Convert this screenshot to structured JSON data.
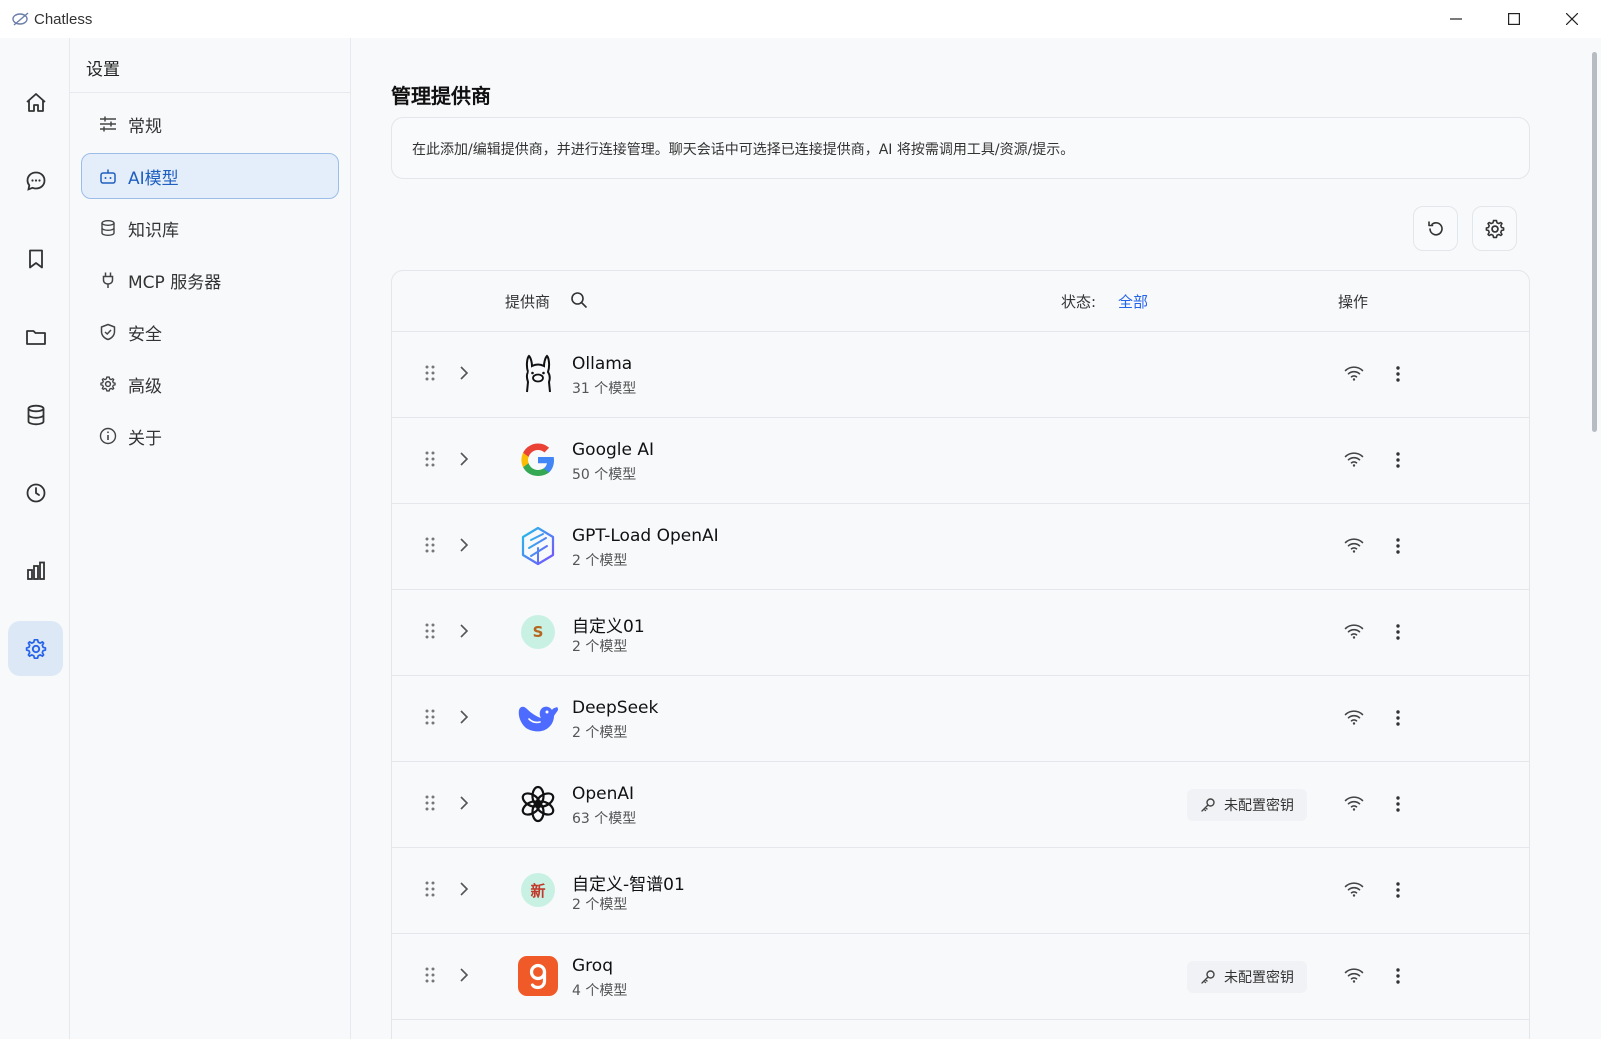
{
  "window": {
    "title": "Chatless"
  },
  "rail": {
    "items": [
      {
        "id": "home",
        "icon": "home-icon"
      },
      {
        "id": "chat",
        "icon": "chat-bubble-icon"
      },
      {
        "id": "bookmarks",
        "icon": "bookmark-icon"
      },
      {
        "id": "files",
        "icon": "folder-icon"
      },
      {
        "id": "database",
        "icon": "database-icon"
      },
      {
        "id": "history",
        "icon": "clock-icon"
      },
      {
        "id": "analytics",
        "icon": "bar-chart-icon"
      },
      {
        "id": "settings",
        "icon": "gear-icon",
        "active": true
      }
    ]
  },
  "sidebar": {
    "title": "设置",
    "items": [
      {
        "label": "常规",
        "icon": "sliders-icon"
      },
      {
        "label": "AI模型",
        "icon": "robot-icon",
        "active": true
      },
      {
        "label": "知识库",
        "icon": "database-icon"
      },
      {
        "label": "MCP 服务器",
        "icon": "plug-icon"
      },
      {
        "label": "安全",
        "icon": "shield-icon"
      },
      {
        "label": "高级",
        "icon": "gear-icon"
      },
      {
        "label": "关于",
        "icon": "info-icon"
      }
    ]
  },
  "main": {
    "title": "管理提供商",
    "description": "在此添加/编辑提供商，并进行连接管理。聊天会话中可选择已连接提供商，AI 将按需调用工具/资源/提示。",
    "toolbar": {
      "refresh_icon": "refresh-icon",
      "settings_icon": "gear-icon"
    },
    "table": {
      "headers": {
        "provider": "提供商",
        "status_label": "状态:",
        "status_value": "全部",
        "actions": "操作"
      },
      "rows": [
        {
          "name": "Ollama",
          "count": "31 个模型",
          "logo": "ollama-logo",
          "badge": null
        },
        {
          "name": "Google AI",
          "count": "50 个模型",
          "logo": "google-logo",
          "badge": null
        },
        {
          "name": "GPT-Load OpenAI",
          "count": "2 个模型",
          "logo": "gpt-load-logo",
          "badge": null
        },
        {
          "name": "自定义01",
          "count": "2 个模型",
          "logo": "letter-s-logo",
          "letter": "S",
          "letter_color": "#b5651d",
          "badge": null
        },
        {
          "name": "DeepSeek",
          "count": "2 个模型",
          "logo": "deepseek-logo",
          "badge": null
        },
        {
          "name": "OpenAI",
          "count": "63 个模型",
          "logo": "openai-logo",
          "badge": "未配置密钥"
        },
        {
          "name": "自定义-智谱01",
          "count": "2 个模型",
          "logo": "letter-xin-logo",
          "letter": "新",
          "letter_color": "#c0392b",
          "badge": null
        },
        {
          "name": "Groq",
          "count": "4 个模型",
          "logo": "groq-logo",
          "badge": "未配置密钥"
        }
      ]
    }
  },
  "colors": {
    "accent": "#2563eb",
    "active_bg": "#e4eefb",
    "border": "#e3e6ea"
  }
}
